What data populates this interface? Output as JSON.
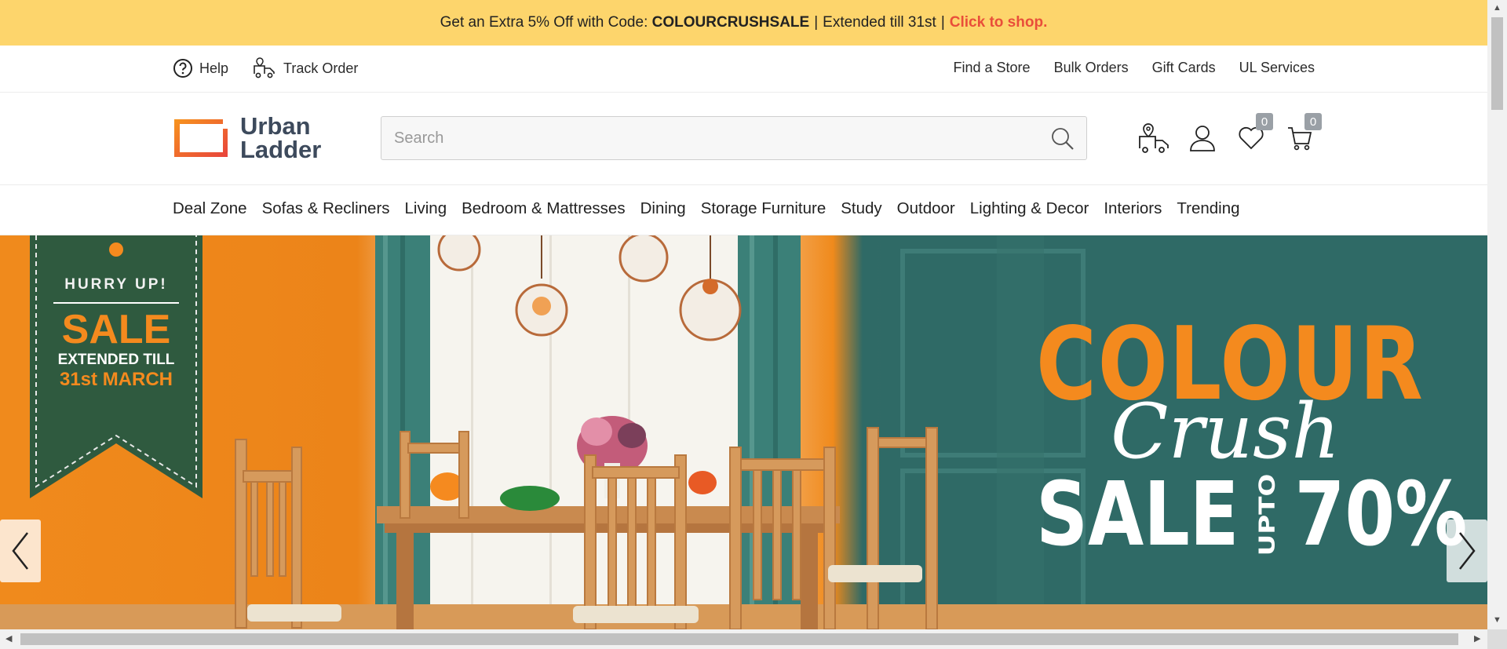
{
  "promo": {
    "text_before": "Get an Extra 5% Off with Code:",
    "code": "COLOURCRUSHSALE",
    "extended": "Extended till 31st",
    "cta": "Click to shop.",
    "background": "#fdd56c",
    "cta_color": "#e94e3a"
  },
  "utility": {
    "help": "Help",
    "track_order": "Track Order",
    "links": [
      "Find a Store",
      "Bulk Orders",
      "Gift Cards",
      "UL Services"
    ]
  },
  "header": {
    "logo_line1": "Urban",
    "logo_line2": "Ladder",
    "search_placeholder": "Search",
    "wishlist_count": "0",
    "cart_count": "0"
  },
  "nav": {
    "items": [
      "Deal Zone",
      "Sofas & Recliners",
      "Living",
      "Bedroom & Mattresses",
      "Dining",
      "Storage Furniture",
      "Study",
      "Outdoor",
      "Lighting & Decor",
      "Interiors",
      "Trending"
    ]
  },
  "hero": {
    "tag_hurry": "HURRY UP!",
    "tag_sale": "SALE",
    "tag_extended": "EXTENDED TILL",
    "tag_date": "31st MARCH",
    "headline_colour": "COLOUR",
    "headline_crush": "Crush",
    "headline_sale": "SALE",
    "headline_upto": "UPTO",
    "headline_percent": "70%",
    "accent_orange": "#f48a1e",
    "accent_teal": "#2f6a66"
  },
  "icons": {
    "help": "help-circle-icon",
    "track": "truck-icon",
    "search": "search-icon",
    "store_locator": "delivery-location-icon",
    "profile": "user-icon",
    "wishlist": "heart-icon",
    "cart": "cart-icon",
    "prev": "chevron-left-icon",
    "next": "chevron-right-icon"
  }
}
